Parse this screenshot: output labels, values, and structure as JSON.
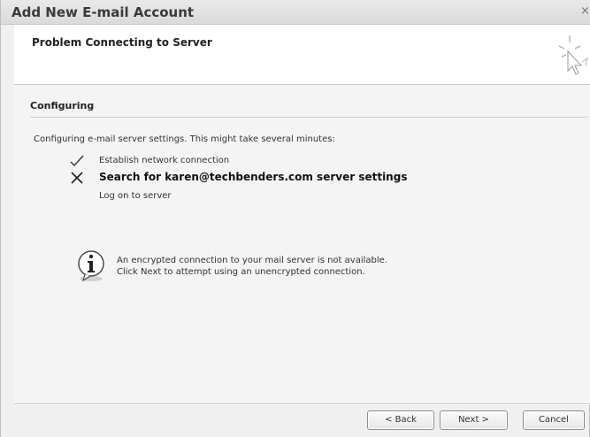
{
  "window": {
    "title": "Add New E-mail Account",
    "close_glyph": "×"
  },
  "header": {
    "heading": "Problem Connecting to Server",
    "icon": "wizard-pointer-icon"
  },
  "configuring": {
    "section_title": "Configuring",
    "intro": "Configuring e-mail server settings. This might take several minutes:",
    "steps": [
      {
        "label": "Establish network connection",
        "status": "done",
        "icon": "checkmark-icon"
      },
      {
        "label": "Search for karen@techbenders.com server settings",
        "status": "failed",
        "icon": "x-mark-icon"
      },
      {
        "label": "Log on to server",
        "status": "pending",
        "icon": ""
      }
    ]
  },
  "info": {
    "icon": "info-icon",
    "line1": "An encrypted connection to your mail server is not available.",
    "line2": "Click Next to attempt using an unencrypted connection."
  },
  "buttons": {
    "back": "< Back",
    "next": "Next >",
    "cancel": "Cancel"
  }
}
